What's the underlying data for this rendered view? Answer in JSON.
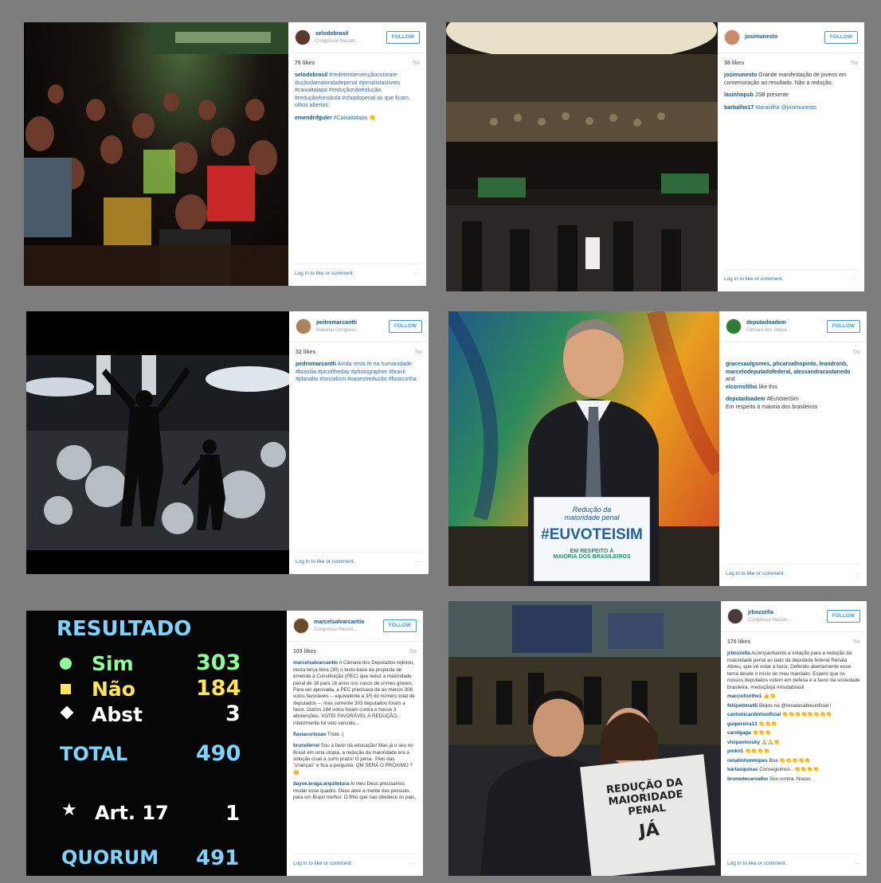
{
  "colors": {
    "bg": "#7d7d7d",
    "link": "#125688",
    "follow": "#3897f0",
    "board_title": "#7fd3ff",
    "board_green": "#8dff9a",
    "board_yellow": "#ffe45c"
  },
  "common": {
    "follow": "FOLLOW",
    "login": "Log in to like or comment.",
    "more": "···"
  },
  "posts": [
    {
      "user": "selodobrasil",
      "location": "Congresso Nacion...",
      "likes": "76 likes",
      "time": "5w",
      "comments": [
        {
          "user": "selodobrasil",
          "text": " #redeteintervençãocontrare duçãodamaioridadepenal #jornalistaslivres #caixaltalapa #reduçãonãoéoluçăo #reduçãoéonsbola #chiadopenal as que ficam, olhos abertos."
        },
        {
          "user": "emendrifguler",
          "text": " #Caixaltalapa 👏"
        }
      ]
    },
    {
      "user": "josimunesto",
      "location": "",
      "likes": "38 likes",
      "time": "5w",
      "comments": [
        {
          "user": "josimunesto",
          "text": " Grande manifestação de jovens em comemoração ao resultado. Não a redução."
        },
        {
          "user": "lasinhopsb",
          "text": " JSB presente"
        },
        {
          "user": "barbalho17",
          "text": " Maravilha @josimunesto"
        }
      ]
    },
    {
      "user": "pedromarcantti",
      "location": "National Congress...",
      "likes": "32 likes",
      "time": "5w",
      "comments": [
        {
          "user": "pedromarcantti",
          "text": " Ainda resta fé na humanidade #brasilia #picoftheday #photographer #brasil #planalto #socialism #nasestreduzão #foracunha"
        }
      ]
    },
    {
      "user": "deputadoadem",
      "location": "Câmara dos Deput...",
      "likes": "",
      "time": "5w",
      "comments": [
        {
          "user": "gracesaulgomes, phcarvalhopinto, leandronb, marcelodeputadofederal, alessandracastanedo",
          "text": " and"
        },
        {
          "user": "elcornsfilho",
          "text": " like this"
        },
        {
          "user": "deputadoadem",
          "text": " #EuVoteiSim\nEm respeito à maioria dos brasileiros"
        }
      ]
    },
    {
      "user": "marcelsalvarcantio",
      "location": "Congresso Nacion...",
      "likes": "103 likes",
      "time": "5w",
      "comments": [
        {
          "user": "marcelsalvarcantio",
          "text": " A Câmara dos Deputados rejeitou, nesta terça-feira (30) o texto-base da proposta de emenda à Constituição (PEC) que reduz a maioridade penal de 18 para 16 anos nos casos de crimes graves. Para ser aprovada, a PEC precisava de ao menos 308 votos favoráveis -- equivalente a 3/5 do número total de deputados --, mas somente 303 deputados foram a favor. Outros 184 votos foram contra e houve 3 abstenções. VOTEI FAVORÁVEL À REDUÇÃO, infelizmente fui voto vencido..."
        },
        {
          "user": "flaviacortezao",
          "text": " Triste :("
        },
        {
          "user": "brunoferrei",
          "text": " Sou a favor da educação! Mas já o seu no Brasil em uma utopia, a redução da maioridade era a solução cruel a curto prazo! O pena.. Pelo das \"crianças\" e fica a pergunta: QM SERÁ O PRÓXIMO ? 😔"
        },
        {
          "user": "dayse.braga.arquitetura",
          "text": " Ai meu Deus precisamos mudar esse quadro. Deus abre a mente das pessoas para um Brasil melhor. O filho que nao obedece os pais,"
        }
      ]
    },
    {
      "user": "jrbozzella",
      "location": "Congresso Nacion...",
      "likes": "170 likes",
      "time": "5w",
      "comments": [
        {
          "user": "jrbozzella",
          "text": " Acompanhando a votação para a redução da maioridade penal ao lado da deputada federal Renata Abreu, que vê votar a favor. Defendo abertamente esse tema desde o início do meu mandato. Espero que os nossos deputados votem em defesa e a favor da sociedade brasileira. #reduçãojá #mudabrasil"
        },
        {
          "user": "marciofonthe1",
          "text": " 👍👏"
        },
        {
          "user": "feliipetima45",
          "text": " Beijos na @renatasabreuoficial !"
        },
        {
          "user": "cantonicardinhooficial",
          "text": " 👏👏👏👏👏👏👏👏"
        },
        {
          "user": "guipereira13",
          "text": " 👏👏👏"
        },
        {
          "user": "carolgaga",
          "text": " 👏👏👏"
        },
        {
          "user": "vivipavlovsky",
          "text": " 🙏🙏👏"
        },
        {
          "user": "pmkn1",
          "text": " 👏👏👏👏"
        },
        {
          "user": "renatinhomlopes",
          "text": " Boa 👏👏👏👏👏"
        },
        {
          "user": "karlasquinas",
          "text": " Conseguimos.. 👏👏👏👏"
        },
        {
          "user": "brunodecarvalho",
          "text": " Sou contra. Nosso"
        }
      ]
    }
  ],
  "sign": {
    "line1": "Redução da",
    "line2": "maioridade penal",
    "hashtag": "#EUVOTEISIM",
    "line3": "EM RESPEITO À",
    "line4": "MAIORIA DOS BRASILEIROS"
  },
  "shirt": {
    "l1": "REDUÇÃO DA",
    "l2": "MAIORIDADE",
    "l3": "PENAL",
    "l4": "JÁ"
  },
  "board": {
    "title": "RESULTADO",
    "sim_label": "Sim",
    "sim": "303",
    "nao_label": "Não",
    "nao": "184",
    "abst_label": "Abst",
    "abst": "3",
    "total_label": "TOTAL",
    "total": "490",
    "art_label": "Art. 17",
    "art": "1",
    "quorum_label": "QUORUM",
    "quorum": "491"
  }
}
